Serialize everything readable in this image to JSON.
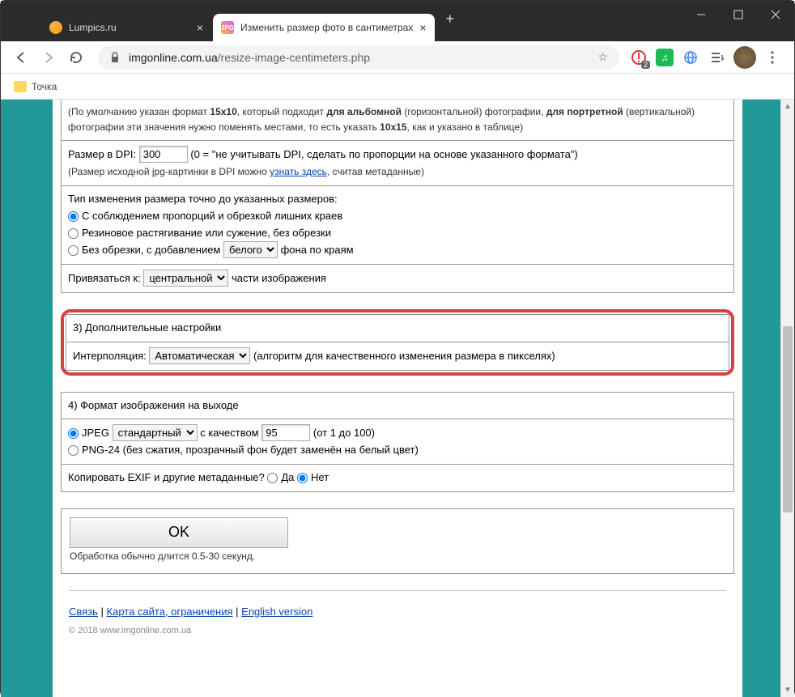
{
  "tabs": [
    {
      "title": "Lumpics.ru"
    },
    {
      "title": "Изменить размер фото в сантиметрах"
    }
  ],
  "address": {
    "domain": "imgonline.com.ua",
    "path": "/resize-image-centimeters.php"
  },
  "bookmarks": {
    "item1": "Точка"
  },
  "section2": {
    "hint_prefix": "(По умолчанию указан формат ",
    "hint_fmt1": "15x10",
    "hint_mid1": ", который подходит ",
    "hint_bold_landscape": "для альбомной",
    "hint_mid2": " (горизонтальной) фотографии, ",
    "hint_bold_portrait": "для портретной",
    "hint_mid3": " (вертикальной) фотографии эти значения нужно поменять местами, то есть указать ",
    "hint_fmt2": "10x15",
    "hint_suffix": ", как и указано в таблице)",
    "dpi_label": "Размер в DPI: ",
    "dpi_value": "300",
    "dpi_hint": " (0 = \"не учитывать DPI, сделать по пропорции на основе указанного формата\")",
    "dpi_note_prefix": "(Размер исходной jpg-картинки в DPI можно ",
    "dpi_note_link": "узнать здесь",
    "dpi_note_suffix": ", считав метаданные)",
    "resize_type_title": "Тип изменения размера точно до указанных размеров:",
    "rt_opt1": "С соблюдением пропорций и обрезкой лишних краев",
    "rt_opt2": "Резиновое растягивание или сужение, без обрезки",
    "rt_opt3_prefix": "Без обрезки, с добавлением ",
    "rt_opt3_select": "белого",
    "rt_opt3_suffix": " фона по краям",
    "anchor_label": "Привязаться к: ",
    "anchor_select": "центральной",
    "anchor_suffix": " части изображения"
  },
  "section3": {
    "title": "3) Дополнительные настройки",
    "interp_label": "Интерполяция: ",
    "interp_value": "Автоматическая",
    "interp_hint": " (алгоритм для качественного изменения размера в пикселях)"
  },
  "section4": {
    "title": "4) Формат изображения на выходе",
    "jpeg_label": "JPEG ",
    "jpeg_select": "стандартный",
    "jpeg_quality_label": " с качеством ",
    "jpeg_quality_value": "95",
    "jpeg_quality_hint": " (от 1 до 100)",
    "png_label": "PNG-24 (без сжатия, прозрачный фон будет заменён на белый цвет)",
    "exif_label": "Копировать EXIF и другие метаданные?  ",
    "exif_yes": "Да  ",
    "exif_no": "Нет"
  },
  "submit": {
    "ok": "OK",
    "note": "Обработка обычно длится 0.5-30 секунд."
  },
  "footer": {
    "contact": "Связь",
    "sitemap": "Карта сайта, ограничения",
    "english": "English version",
    "copyright": "© 2018 www.imgonline.com.ua"
  },
  "ext_badge": "2"
}
